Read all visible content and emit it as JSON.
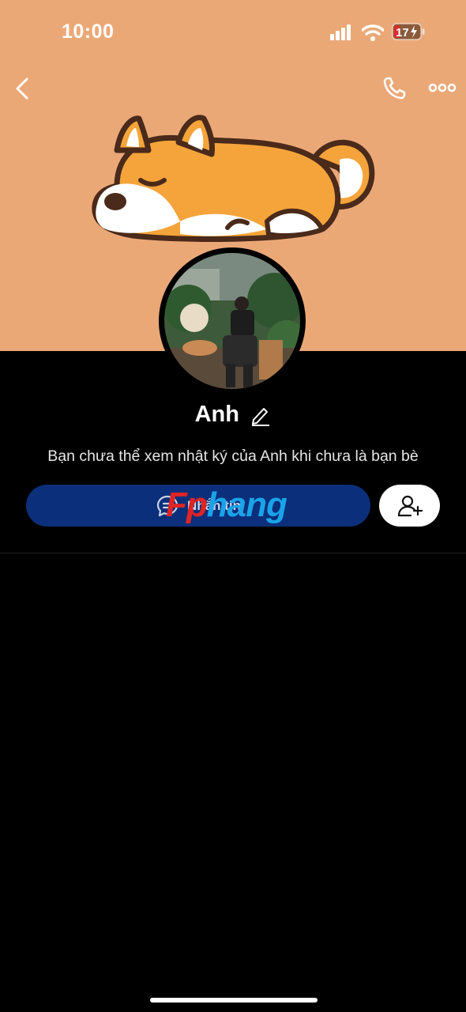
{
  "status_bar": {
    "time": "10:00",
    "battery_level": "17",
    "signal_icon": "cellular-signal-icon",
    "wifi_icon": "wifi-icon",
    "battery_icon": "battery-charging-icon"
  },
  "nav": {
    "back_icon": "chevron-left-icon",
    "call_icon": "phone-icon",
    "more_icon": "more-horizontal-icon"
  },
  "profile": {
    "name": "Anh",
    "edit_icon": "pencil-icon",
    "notice": "Bạn chưa thể xem nhật ký của Anh khi chưa là bạn bè"
  },
  "actions": {
    "message_label": "Nhắn tin",
    "message_icon": "chat-bubble-icon",
    "add_friend_icon": "add-friend-icon"
  },
  "watermark": {
    "part1": "Fp",
    "part2": "hang"
  },
  "colors": {
    "cover_bg": "#eba877",
    "message_button": "#0b2f7a",
    "background": "#000000"
  }
}
